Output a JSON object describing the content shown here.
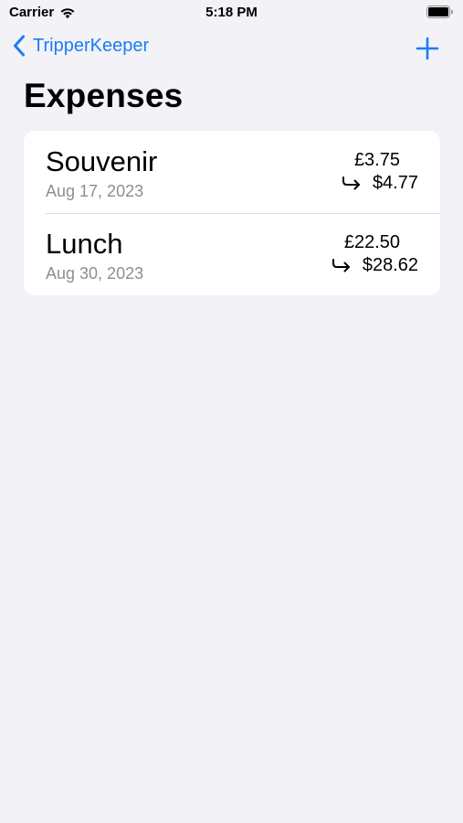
{
  "status_bar": {
    "carrier": "Carrier",
    "time": "5:18 PM"
  },
  "nav": {
    "back_label": "TripperKeeper",
    "accent_color": "#1c7cf4"
  },
  "page": {
    "title": "Expenses"
  },
  "expenses": [
    {
      "name": "Souvenir",
      "date": "Aug 17, 2023",
      "original_amount": "£3.75",
      "converted_amount": "$4.77"
    },
    {
      "name": "Lunch",
      "date": "Aug 30, 2023",
      "original_amount": "£22.50",
      "converted_amount": "$28.62"
    }
  ],
  "icons": {
    "wifi": "wifi-icon",
    "battery": "battery-icon",
    "back": "chevron-left-icon",
    "add": "plus-icon",
    "converted": "arrow-turn-right-icon"
  }
}
